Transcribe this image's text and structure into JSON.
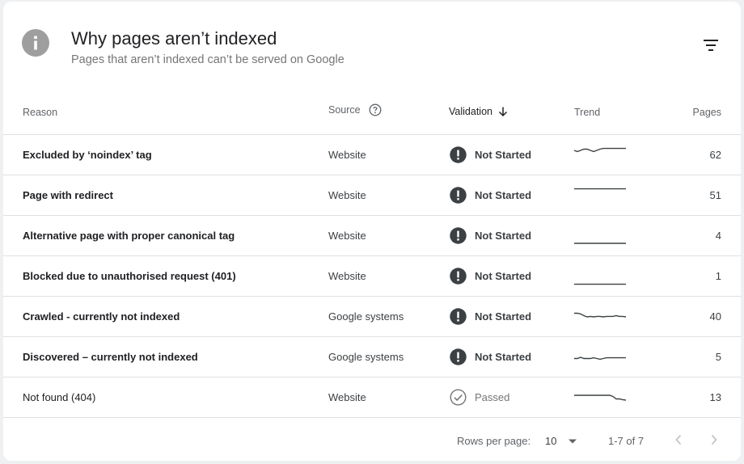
{
  "header": {
    "title": "Why pages aren’t indexed",
    "subtitle": "Pages that aren’t indexed can’t be served on Google",
    "icon": "info-icon",
    "filter_icon": "filter-icon"
  },
  "table": {
    "columns": {
      "reason": "Reason",
      "source": "Source",
      "validation": "Validation",
      "trend": "Trend",
      "pages": "Pages"
    },
    "sort": {
      "column": "validation",
      "direction": "descending"
    },
    "rows": [
      {
        "reason": "Excluded by ‘noindex’ tag",
        "source": "Website",
        "validation": "Not Started",
        "status_icon": "alert-icon",
        "pages": "62",
        "bold": true,
        "trend": [
          0.3,
          0.35,
          0.3,
          0.25,
          0.25,
          0.3,
          0.35,
          0.3,
          0.25,
          0.22,
          0.22,
          0.22,
          0.22,
          0.22,
          0.22,
          0.22,
          0.22
        ]
      },
      {
        "reason": "Page with redirect",
        "source": "Website",
        "validation": "Not Started",
        "status_icon": "alert-icon",
        "pages": "51",
        "bold": true,
        "trend": [
          0.22,
          0.22,
          0.22,
          0.22,
          0.22,
          0.22,
          0.22,
          0.22,
          0.22,
          0.22,
          0.22,
          0.22,
          0.22,
          0.22,
          0.22,
          0.22,
          0.22
        ]
      },
      {
        "reason": "Alternative page with proper canonical tag",
        "source": "Website",
        "validation": "Not Started",
        "status_icon": "alert-icon",
        "pages": "4",
        "bold": true,
        "trend": [
          0.8,
          0.8,
          0.8,
          0.8,
          0.8,
          0.8,
          0.8,
          0.8,
          0.8,
          0.8,
          0.8,
          0.8,
          0.8,
          0.8,
          0.8,
          0.8,
          0.8
        ]
      },
      {
        "reason": "Blocked due to unauthorised request (401)",
        "source": "Website",
        "validation": "Not Started",
        "status_icon": "alert-icon",
        "pages": "1",
        "bold": true,
        "trend": [
          0.82,
          0.82,
          0.82,
          0.82,
          0.82,
          0.82,
          0.82,
          0.82,
          0.82,
          0.82,
          0.82,
          0.82,
          0.82,
          0.82,
          0.82,
          0.82,
          0.82
        ]
      },
      {
        "reason": "Crawled - currently not indexed",
        "source": "Google systems",
        "validation": "Not Started",
        "status_icon": "alert-icon",
        "pages": "40",
        "bold": true,
        "trend": [
          0.35,
          0.35,
          0.38,
          0.45,
          0.5,
          0.48,
          0.5,
          0.48,
          0.48,
          0.5,
          0.48,
          0.48,
          0.48,
          0.45,
          0.48,
          0.48,
          0.5
        ]
      },
      {
        "reason": "Discovered – currently not indexed",
        "source": "Google systems",
        "validation": "Not Started",
        "status_icon": "alert-icon",
        "pages": "5",
        "bold": true,
        "trend": [
          0.55,
          0.55,
          0.5,
          0.55,
          0.55,
          0.55,
          0.52,
          0.55,
          0.58,
          0.55,
          0.52,
          0.52,
          0.52,
          0.52,
          0.52,
          0.52,
          0.52
        ]
      },
      {
        "reason": "Not found (404)",
        "source": "Website",
        "validation": "Passed",
        "status_icon": "check-circle-icon",
        "pages": "13",
        "bold": false,
        "trend": [
          0.4,
          0.4,
          0.4,
          0.4,
          0.4,
          0.4,
          0.4,
          0.4,
          0.4,
          0.4,
          0.4,
          0.4,
          0.45,
          0.55,
          0.55,
          0.58,
          0.6
        ]
      }
    ]
  },
  "footer": {
    "rows_per_page_label": "Rows per page:",
    "rows_per_page_value": "10",
    "range": "1-7 of 7"
  },
  "colors": {
    "alert": "#3c4043",
    "passed": "#757575",
    "trend_line": "#3c4043",
    "info_icon_bg": "#9e9e9e"
  }
}
